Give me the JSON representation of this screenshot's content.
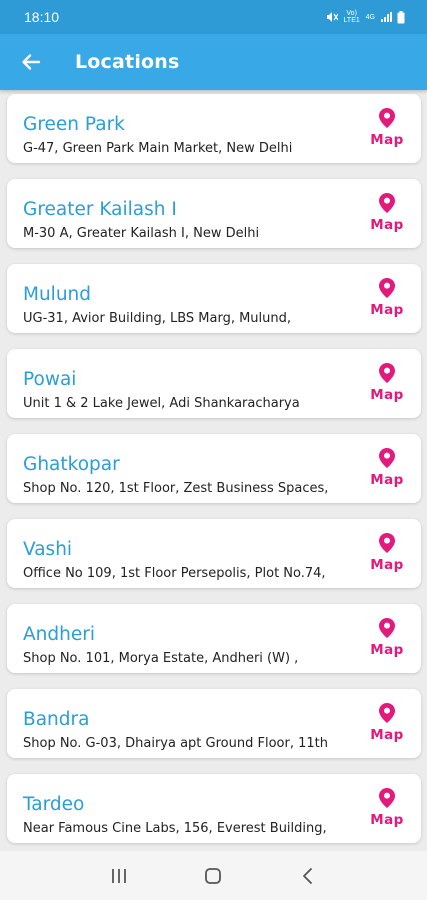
{
  "status_bar": {
    "time": "18:10",
    "icons": [
      "mute-icon",
      "volte-icon",
      "signal-icon",
      "battery-icon"
    ],
    "volte_label": "Vo) LTE1",
    "network_label": "4G"
  },
  "app_bar": {
    "title": "Locations",
    "back_icon": "arrow-left-icon"
  },
  "locations": [
    {
      "name": "Green Park",
      "address": "G-47, Green Park Main Market, New Delhi",
      "map_label": "Map"
    },
    {
      "name": "Greater Kailash I",
      "address": "M-30 A, Greater Kailash I, New Delhi",
      "map_label": "Map"
    },
    {
      "name": "Mulund",
      "address": "UG-31, Avior Building, LBS Marg, Mulund,",
      "map_label": "Map"
    },
    {
      "name": "Powai",
      "address": "Unit 1 & 2 Lake Jewel, Adi Shankaracharya",
      "map_label": "Map"
    },
    {
      "name": "Ghatkopar",
      "address": "Shop No. 120, 1st Floor, Zest Business Spaces,",
      "map_label": "Map"
    },
    {
      "name": "Vashi",
      "address": "Office No 109, 1st Floor Persepolis, Plot No.74,",
      "map_label": "Map"
    },
    {
      "name": "Andheri",
      "address": "Shop No. 101, Morya Estate, Andheri (W) ,",
      "map_label": "Map"
    },
    {
      "name": "Bandra",
      "address": "Shop No. G-03, Dhairya apt Ground Floor, 11th",
      "map_label": "Map"
    },
    {
      "name": "Tardeo",
      "address": "Near Famous Cine Labs, 156, Everest Building,",
      "map_label": "Map"
    }
  ],
  "nav_bar": {
    "icons": [
      "recent-apps-icon",
      "home-icon",
      "back-icon"
    ]
  },
  "colors": {
    "status_bar": "#2e9bd6",
    "app_bar": "#39a8e6",
    "location_name": "#2a9ed8",
    "map_accent": "#e3197c",
    "background": "#ececec"
  }
}
